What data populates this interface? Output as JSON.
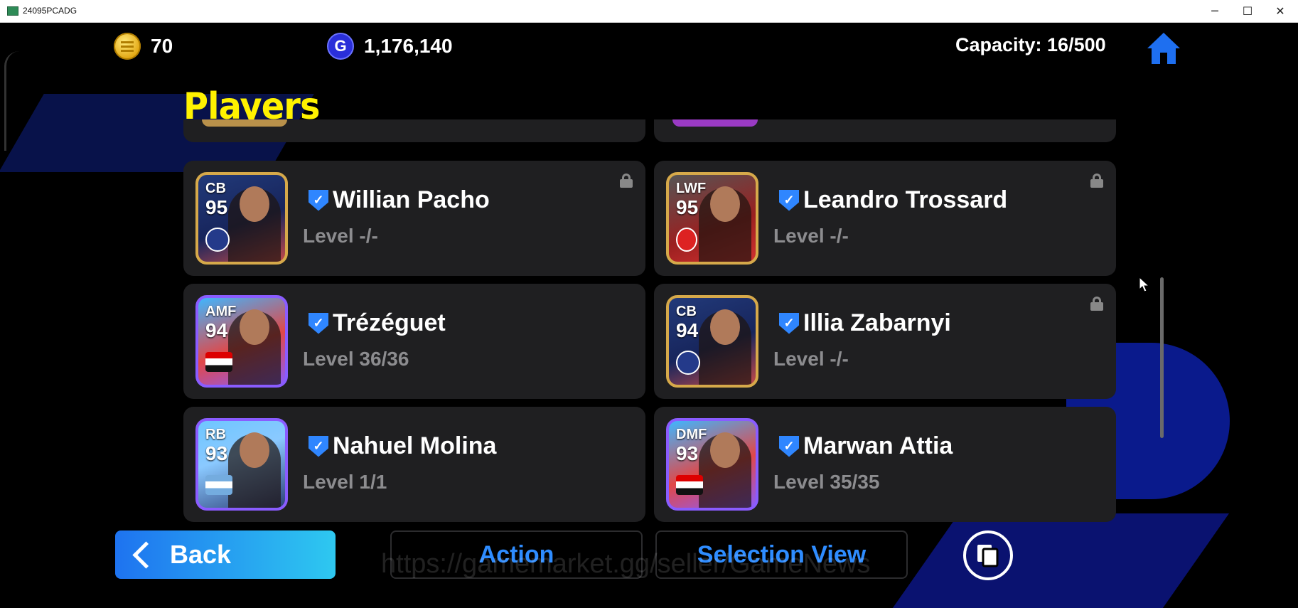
{
  "window": {
    "title": "24095PCADG",
    "controls": {
      "minimize": "─",
      "maximize": "☐",
      "close": "✕"
    }
  },
  "hud": {
    "coins": "70",
    "gp": "1,176,140",
    "gp_icon_letter": "G",
    "capacity": "Capacity: 16/500",
    "icons": {
      "coins": "ecoin-icon",
      "gp": "gp-icon",
      "home": "home-icon"
    }
  },
  "page": {
    "title": "Players"
  },
  "players": [
    {
      "position": "CB",
      "rating": "95",
      "name": "Willian Pacho",
      "level": "Level -/-",
      "locked": true,
      "card_style": "gold"
    },
    {
      "position": "LWF",
      "rating": "95",
      "name": "Leandro Trossard",
      "level": "Level -/-",
      "locked": true,
      "card_style": "gold-red"
    },
    {
      "position": "AMF",
      "rating": "94",
      "name": "Trézéguet",
      "level": "Level 36/36",
      "locked": false,
      "card_style": "epic"
    },
    {
      "position": "CB",
      "rating": "94",
      "name": "Illia Zabarnyi",
      "level": "Level -/-",
      "locked": true,
      "card_style": "gold"
    },
    {
      "position": "RB",
      "rating": "93",
      "name": "Nahuel Molina",
      "level": "Level 1/1",
      "locked": false,
      "card_style": "epic-blue"
    },
    {
      "position": "DMF",
      "rating": "93",
      "name": "Marwan Attia",
      "level": "Level 35/35",
      "locked": false,
      "card_style": "epic"
    }
  ],
  "footer": {
    "back_label": "Back",
    "action_label": "Action",
    "selection_view_label": "Selection View"
  },
  "watermark": "https://gamemarket.gg/seller/GameNews",
  "colors": {
    "title_yellow": "#fff200",
    "accent_blue": "#2e8cff",
    "card_bg": "#1f1f21",
    "verified_badge": "#2f86ff"
  }
}
